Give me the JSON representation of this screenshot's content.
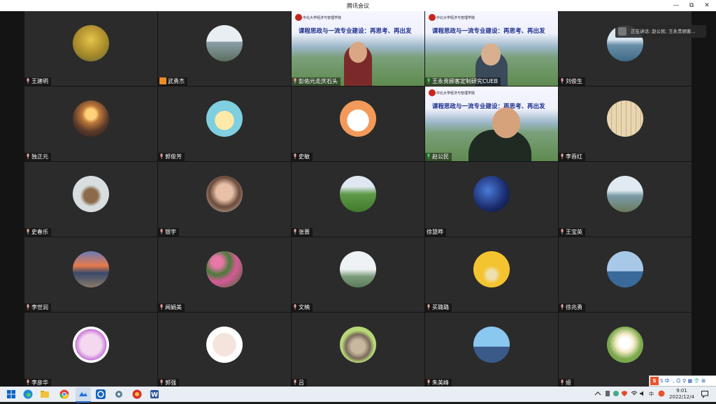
{
  "window": {
    "title": "腾讯会议",
    "minimize": "—",
    "restore": "⧉",
    "close": "✕"
  },
  "speaking": {
    "text": "正在讲话: 赵公民; 王永贵顾客..."
  },
  "video_title": "课程思政与一流专业建设：再思考、再出发",
  "video_header": "中北大学经济与管理学院",
  "participants": {
    "r0c0": "王建明",
    "r0c1": "武勇杰",
    "r0c2": "彭佑元走庆石头",
    "r0c3": "王永贵顾客定制研究CUEB",
    "r0c4": "刘俊生",
    "r1c0": "独正元",
    "r1c1": "郭俊芳",
    "r1c2": "史敏",
    "r1c3": "赵公民",
    "r1c4": "李晋红",
    "r2c0": "史春乐",
    "r2c1": "银宇",
    "r2c2": "张蔷",
    "r2c3": "徐慧晔",
    "r2c4": "王宝英",
    "r3c0": "李世润",
    "r3c1": "闻娟美",
    "r3c2": "文楠",
    "r3c3": "买璐璐",
    "r3c4": "徐兆勇",
    "r4c0": "李彦华",
    "r4c1": "郭强",
    "r4c2": "吕",
    "r4c3": "朱美峰",
    "r4c4": "娅"
  },
  "taskbar": {
    "ime_text": "S 中 ·, ☺ ⚲ ▦ 👕 ⊞",
    "tray_lang": "中",
    "time": "9:01",
    "date": "2022/12/4"
  },
  "colors": {
    "accent": "#f08a24",
    "bg": "#2b2b2b",
    "video_title": "#1a2d8c"
  }
}
